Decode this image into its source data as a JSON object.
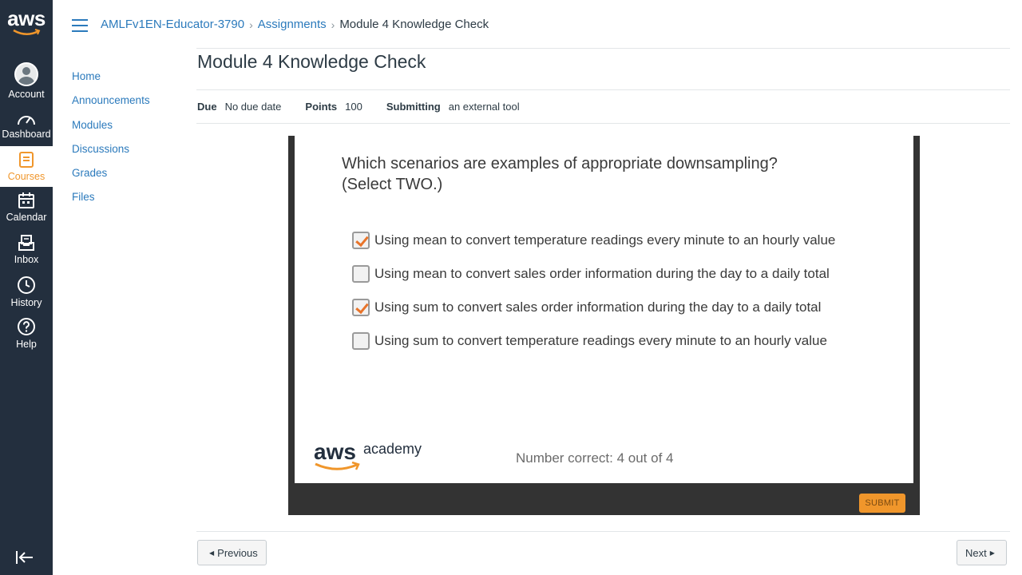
{
  "global_nav": {
    "logo": "aws",
    "items": [
      {
        "label": "Account",
        "icon": "account-icon"
      },
      {
        "label": "Dashboard",
        "icon": "dashboard-icon"
      },
      {
        "label": "Courses",
        "icon": "courses-icon"
      },
      {
        "label": "Calendar",
        "icon": "calendar-icon"
      },
      {
        "label": "Inbox",
        "icon": "inbox-icon"
      },
      {
        "label": "History",
        "icon": "history-icon"
      },
      {
        "label": "Help",
        "icon": "help-icon"
      }
    ],
    "active": "Courses"
  },
  "breadcrumb": {
    "course": "AMLFv1EN-Educator-3790",
    "section": "Assignments",
    "current": "Module 4 Knowledge Check"
  },
  "course_nav": [
    "Home",
    "Announcements",
    "Modules",
    "Discussions",
    "Grades",
    "Files"
  ],
  "page": {
    "title": "Module 4 Knowledge Check",
    "details": {
      "due_label": "Due",
      "due_value": "No due date",
      "points_label": "Points",
      "points_value": "100",
      "submitting_label": "Submitting",
      "submitting_value": "an external tool"
    }
  },
  "quiz": {
    "question_line1": "Which scenarios are examples of appropriate downsampling?",
    "question_line2": "(Select TWO.)",
    "options": [
      {
        "text": "Using mean to convert temperature readings every minute to an hourly value",
        "checked": true
      },
      {
        "text": "Using mean to convert sales order information during the day to a daily total",
        "checked": false
      },
      {
        "text": "Using sum to convert sales order information during the day to a daily total",
        "checked": true
      },
      {
        "text": "Using sum to convert temperature readings every minute to an hourly value",
        "checked": false
      }
    ],
    "brand_aws": "aws",
    "brand_academy": "academy",
    "score": "Number correct: 4 out of 4",
    "submit_label": "SUBMIT"
  },
  "footer": {
    "previous_label": "Previous",
    "next_label": "Next"
  },
  "colors": {
    "nav_bg": "#232f3e",
    "accent": "#f0962b",
    "link": "#2b7abc"
  }
}
